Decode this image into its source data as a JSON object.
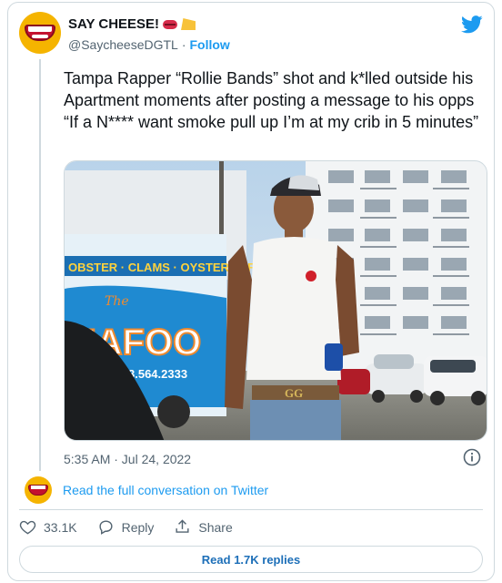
{
  "author": {
    "display_name": "SAY CHEESE!",
    "handle": "@SaycheeseDGTL",
    "separator": "·",
    "follow_label": "Follow"
  },
  "tweet": {
    "text": "Tampa Rapper “Rollie Bands” shot and k*lled outside his Apartment moments after posting a message to his opps “If a N**** want smoke pull up I’m at my crib in 5 minutes”",
    "timestamp": "5:35 AM · Jul 24, 2022"
  },
  "photo": {
    "truck_banner": "OBSTER · CLAMS · OYSTERS · FI",
    "truck_brand_top": "The",
    "truck_brand": "EAFOO",
    "truck_phone": "3.564.2333",
    "belt_logo": "GG"
  },
  "conversation": {
    "link_label": "Read the full conversation on Twitter"
  },
  "actions": {
    "like_count": "33.1K",
    "reply_label": "Reply",
    "share_label": "Share"
  },
  "replies_button": {
    "label": "Read 1.7K replies"
  },
  "colors": {
    "twitter_blue": "#1d9bf0",
    "brand_yellow": "#f5b400",
    "text_primary": "#0f1419",
    "text_secondary": "#536471"
  }
}
